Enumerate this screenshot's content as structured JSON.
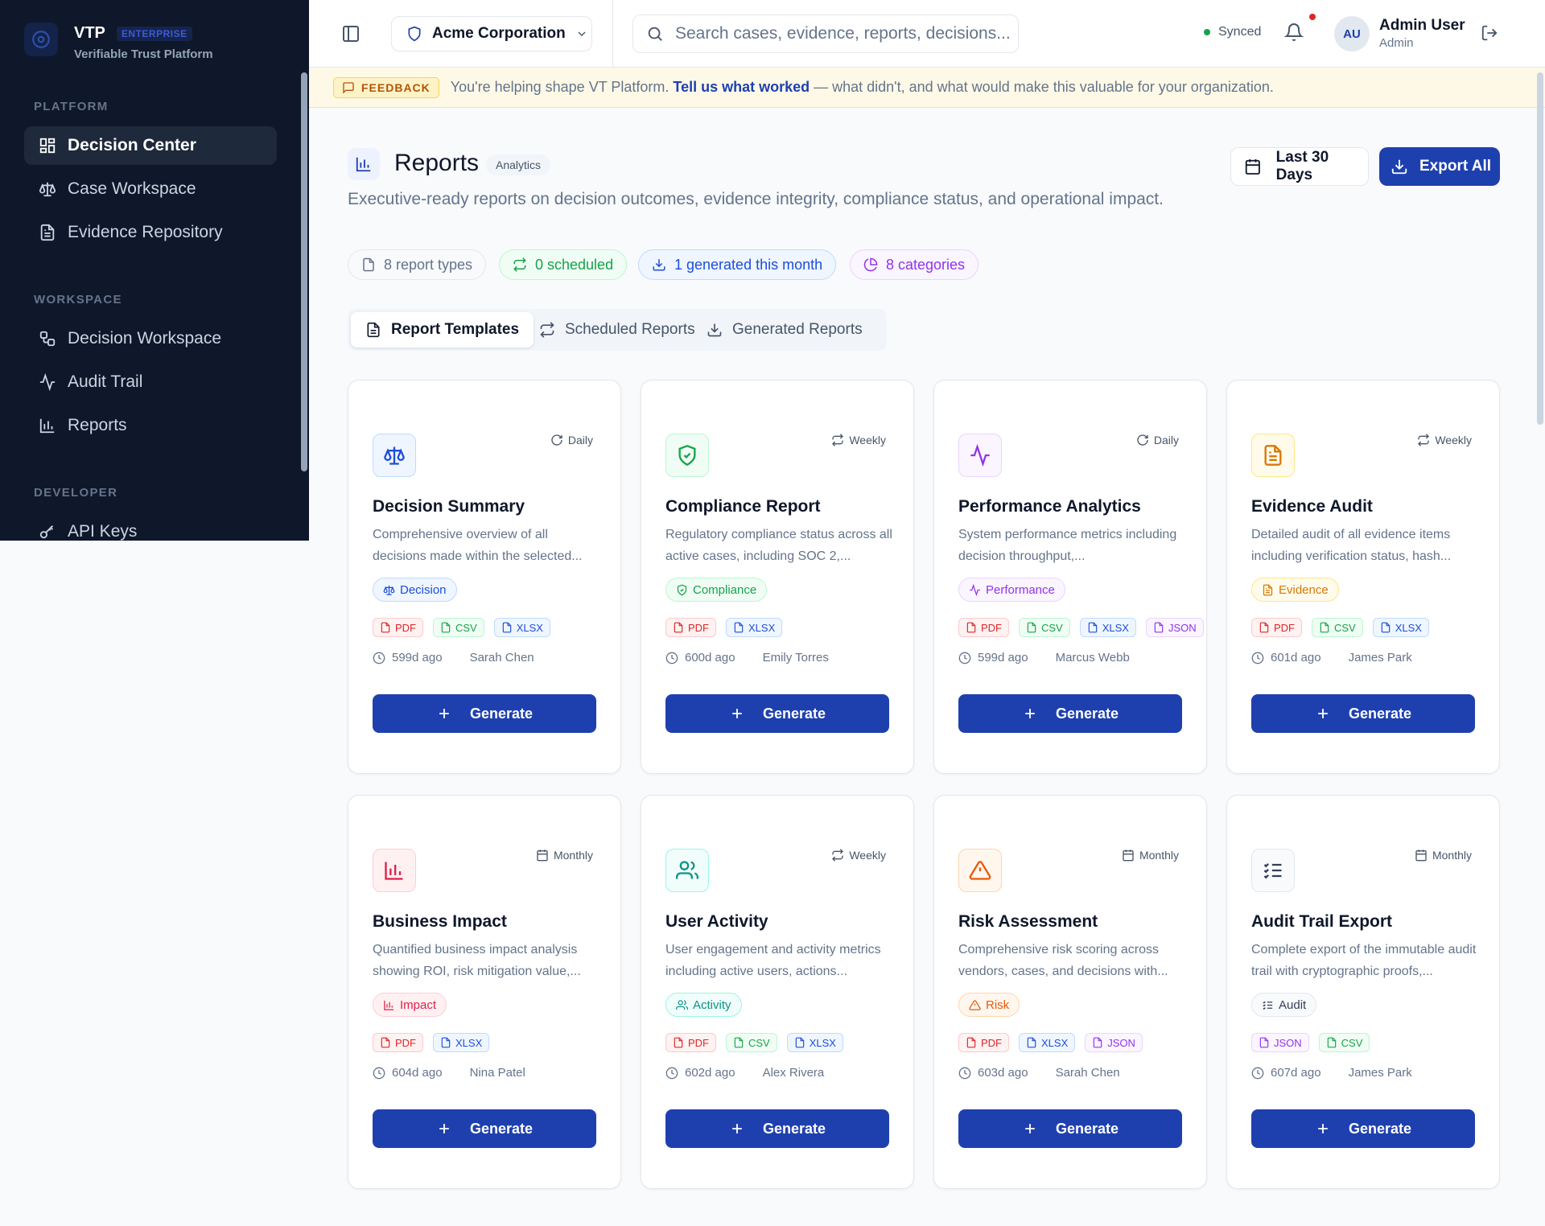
{
  "sidebar": {
    "brand_name": "VTP",
    "brand_badge": "ENTERPRISE",
    "brand_sub": "Verifiable Trust Platform",
    "sections": {
      "platform": "PLATFORM",
      "workspace": "WORKSPACE",
      "developer": "DEVELOPER"
    },
    "items": [
      {
        "label": "Decision Center",
        "icon": "grid-icon",
        "active": true
      },
      {
        "label": "Case Workspace",
        "icon": "scale-icon"
      },
      {
        "label": "Evidence Repository",
        "icon": "file-text-icon"
      },
      {
        "label": "Decision Workspace",
        "icon": "workflow-icon"
      },
      {
        "label": "Audit Trail",
        "icon": "activity-icon"
      },
      {
        "label": "Reports",
        "icon": "bar-chart-icon"
      },
      {
        "label": "API Keys",
        "icon": "key-icon"
      }
    ]
  },
  "header": {
    "org": "Acme Corporation",
    "search_placeholder": "Search cases, evidence, reports, decisions...",
    "sync_status": "Synced",
    "user_initials": "AU",
    "user_name": "Admin User",
    "user_role": "Admin"
  },
  "feedback": {
    "tag": "FEEDBACK",
    "text_before": "You're helping shape VT Platform.",
    "link": "Tell us what worked",
    "text_after": "— what didn't, and what would make this valuable for your organization."
  },
  "page": {
    "title": "Reports",
    "badge": "Analytics",
    "description": "Executive-ready reports on decision outcomes, evidence integrity, compliance status, and operational impact.",
    "range_label": "Last 30 Days",
    "export_label": "Export All"
  },
  "stats": [
    "8 report types",
    "0 scheduled",
    "1 generated this month",
    "8 categories"
  ],
  "tabs": [
    {
      "label": "Report Templates",
      "active": true
    },
    {
      "label": "Scheduled Reports"
    },
    {
      "label": "Generated Reports"
    }
  ],
  "generate_label": "Generate",
  "cards": [
    {
      "title": "Decision Summary",
      "freq": "Daily",
      "desc": "Comprehensive overview of all decisions made within the selected...",
      "category": "Decision",
      "formats": [
        "PDF",
        "CSV",
        "XLSX"
      ],
      "age": "599d ago",
      "author": "Sarah Chen",
      "color": "#1d4ed8",
      "bg": "#eff6ff",
      "border": "#bfdbfe",
      "icon": "scale-icon"
    },
    {
      "title": "Compliance Report",
      "freq": "Weekly",
      "desc": "Regulatory compliance status across all active cases, including SOC 2,...",
      "category": "Compliance",
      "formats": [
        "PDF",
        "XLSX"
      ],
      "age": "600d ago",
      "author": "Emily Torres",
      "color": "#16a34a",
      "bg": "#f0fdf4",
      "border": "#bbf7d0",
      "icon": "shield-check-icon"
    },
    {
      "title": "Performance Analytics",
      "freq": "Daily",
      "desc": "System performance metrics including decision throughput,...",
      "category": "Performance",
      "formats": [
        "PDF",
        "CSV",
        "XLSX",
        "JSON"
      ],
      "age": "599d ago",
      "author": "Marcus Webb",
      "color": "#9333ea",
      "bg": "#faf5ff",
      "border": "#e9d5ff",
      "icon": "activity-icon"
    },
    {
      "title": "Evidence Audit",
      "freq": "Weekly",
      "desc": "Detailed audit of all evidence items including verification status, hash...",
      "category": "Evidence",
      "formats": [
        "PDF",
        "CSV",
        "XLSX"
      ],
      "age": "601d ago",
      "author": "James Park",
      "color": "#d97706",
      "bg": "#fffbeb",
      "border": "#fde68a",
      "icon": "file-text-icon"
    },
    {
      "title": "Business Impact",
      "freq": "Monthly",
      "desc": "Quantified business impact analysis showing ROI, risk mitigation value,...",
      "category": "Impact",
      "formats": [
        "PDF",
        "XLSX"
      ],
      "age": "604d ago",
      "author": "Nina Patel",
      "color": "#e11d48",
      "bg": "#fff1f2",
      "border": "#fecdd3",
      "icon": "bar-chart-icon"
    },
    {
      "title": "User Activity",
      "freq": "Weekly",
      "desc": "User engagement and activity metrics including active users, actions...",
      "category": "Activity",
      "formats": [
        "PDF",
        "CSV",
        "XLSX"
      ],
      "age": "602d ago",
      "author": "Alex Rivera",
      "color": "#0d9488",
      "bg": "#f0fdfa",
      "border": "#99f6e4",
      "icon": "users-icon"
    },
    {
      "title": "Risk Assessment",
      "freq": "Monthly",
      "desc": "Comprehensive risk scoring across vendors, cases, and decisions with...",
      "category": "Risk",
      "formats": [
        "PDF",
        "XLSX",
        "JSON"
      ],
      "age": "603d ago",
      "author": "Sarah Chen",
      "color": "#ea580c",
      "bg": "#fff7ed",
      "border": "#fed7aa",
      "icon": "alert-triangle-icon"
    },
    {
      "title": "Audit Trail Export",
      "freq": "Monthly",
      "desc": "Complete export of the immutable audit trail with cryptographic proofs,...",
      "category": "Audit",
      "formats": [
        "JSON",
        "CSV"
      ],
      "age": "607d ago",
      "author": "James Park",
      "color": "#334155",
      "bg": "#f8fafc",
      "border": "#e2e8f0",
      "icon": "list-checks-icon"
    }
  ]
}
